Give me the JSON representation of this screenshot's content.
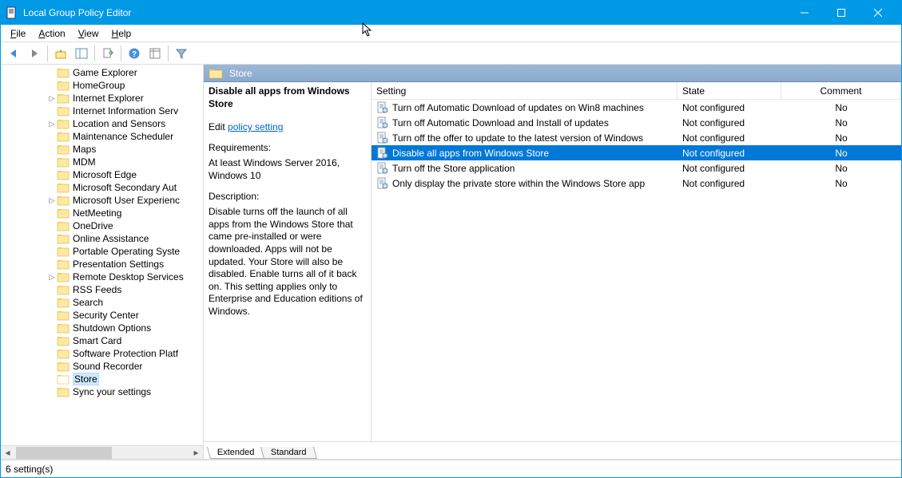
{
  "window": {
    "title": "Local Group Policy Editor"
  },
  "menubar": {
    "file": "File",
    "action": "Action",
    "view": "View",
    "help": "Help"
  },
  "breadcrumb": {
    "label": "Store"
  },
  "tree": {
    "items": [
      {
        "label": "Game Explorer",
        "expandable": false
      },
      {
        "label": "HomeGroup",
        "expandable": false
      },
      {
        "label": "Internet Explorer",
        "expandable": true
      },
      {
        "label": "Internet Information Serv",
        "expandable": false
      },
      {
        "label": "Location and Sensors",
        "expandable": true
      },
      {
        "label": "Maintenance Scheduler",
        "expandable": false
      },
      {
        "label": "Maps",
        "expandable": false
      },
      {
        "label": "MDM",
        "expandable": false
      },
      {
        "label": "Microsoft Edge",
        "expandable": false
      },
      {
        "label": "Microsoft Secondary Aut",
        "expandable": false
      },
      {
        "label": "Microsoft User Experienc",
        "expandable": true
      },
      {
        "label": "NetMeeting",
        "expandable": false
      },
      {
        "label": "OneDrive",
        "expandable": false
      },
      {
        "label": "Online Assistance",
        "expandable": false
      },
      {
        "label": "Portable Operating Syste",
        "expandable": false
      },
      {
        "label": "Presentation Settings",
        "expandable": false
      },
      {
        "label": "Remote Desktop Services",
        "expandable": true
      },
      {
        "label": "RSS Feeds",
        "expandable": false
      },
      {
        "label": "Search",
        "expandable": false
      },
      {
        "label": "Security Center",
        "expandable": false
      },
      {
        "label": "Shutdown Options",
        "expandable": false
      },
      {
        "label": "Smart Card",
        "expandable": false
      },
      {
        "label": "Software Protection Platf",
        "expandable": false
      },
      {
        "label": "Sound Recorder",
        "expandable": false
      },
      {
        "label": "Store",
        "expandable": false,
        "selected": true
      },
      {
        "label": "Sync your settings",
        "expandable": false
      }
    ]
  },
  "details": {
    "title": "Disable all apps from Windows Store",
    "edit_prefix": "Edit ",
    "edit_link": "policy setting",
    "req_label": "Requirements:",
    "req_text": "At least Windows Server 2016, Windows 10",
    "desc_label": "Description:",
    "desc_text": "Disable turns off the launch of all apps from the Windows Store that came pre-installed or were downloaded. Apps will not be updated. Your Store will also be disabled. Enable turns all of it back on. This setting applies only to Enterprise and Education editions of Windows."
  },
  "listview": {
    "columns": {
      "setting": "Setting",
      "state": "State",
      "comment": "Comment"
    },
    "rows": [
      {
        "setting": "Turn off Automatic Download of updates on Win8 machines",
        "state": "Not configured",
        "comment": "No"
      },
      {
        "setting": "Turn off Automatic Download and Install of updates",
        "state": "Not configured",
        "comment": "No"
      },
      {
        "setting": "Turn off the offer to update to the latest version of Windows",
        "state": "Not configured",
        "comment": "No"
      },
      {
        "setting": "Disable all apps from Windows Store",
        "state": "Not configured",
        "comment": "No",
        "selected": true
      },
      {
        "setting": "Turn off the Store application",
        "state": "Not configured",
        "comment": "No"
      },
      {
        "setting": "Only display the private store within the Windows Store app",
        "state": "Not configured",
        "comment": "No"
      }
    ]
  },
  "tabs": {
    "extended": "Extended",
    "standard": "Standard"
  },
  "statusbar": {
    "text": "6 setting(s)"
  }
}
